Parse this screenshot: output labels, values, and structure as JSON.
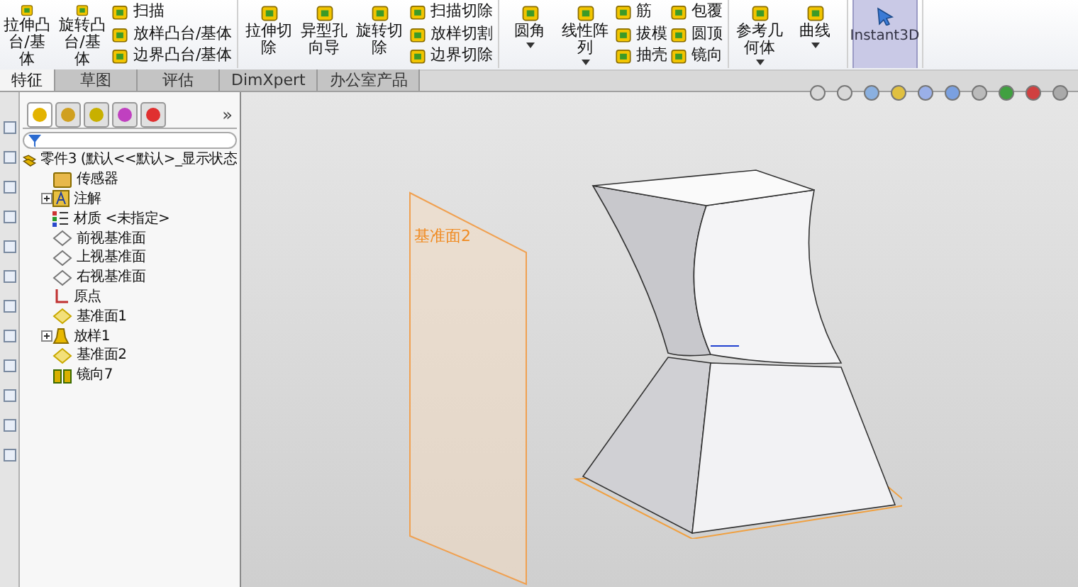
{
  "ribbon": {
    "groups": [
      [
        {
          "kind": "large",
          "label": "拉伸凸台/基体"
        },
        {
          "kind": "large",
          "label": "旋转凸台/基体"
        },
        {
          "kind": "stack",
          "items": [
            "扫描",
            "放样凸台/基体",
            "边界凸台/基体"
          ]
        }
      ],
      [
        {
          "kind": "large",
          "label": "拉伸切除"
        },
        {
          "kind": "large",
          "label": "异型孔向导"
        },
        {
          "kind": "large",
          "label": "旋转切除"
        },
        {
          "kind": "stack",
          "items": [
            "扫描切除",
            "放样切割",
            "边界切除"
          ]
        }
      ],
      [
        {
          "kind": "large",
          "label": "圆角",
          "dropdown": true
        },
        {
          "kind": "large",
          "label": "线性阵列",
          "dropdown": true
        },
        {
          "kind": "stack",
          "items": [
            "筋",
            "拔模",
            "抽壳"
          ]
        },
        {
          "kind": "stack",
          "items": [
            "包覆",
            "圆顶",
            "镜向"
          ]
        }
      ],
      [
        {
          "kind": "large",
          "label": "参考几何体",
          "dropdown": true
        },
        {
          "kind": "large",
          "label": "曲线",
          "dropdown": true
        }
      ],
      [
        {
          "kind": "toggle",
          "label": "Instant3D",
          "on": true
        }
      ]
    ]
  },
  "tabs": [
    {
      "label": "特征",
      "selected": true
    },
    {
      "label": "草图",
      "selected": false
    },
    {
      "label": "评估",
      "selected": false
    },
    {
      "label": "DimXpert",
      "selected": false
    },
    {
      "label": "办公室产品",
      "selected": false
    }
  ],
  "tree_panel": {
    "more": "»",
    "tree": [
      {
        "label": "零件3 (默认<<默认>_显示状态",
        "kind": "part",
        "collapsed": false,
        "children": [
          {
            "label": "传感器",
            "kind": "sensor",
            "collapsed": false
          },
          {
            "label": "注解",
            "kind": "annotation",
            "collapsed": true
          },
          {
            "label": "材质 <未指定>",
            "kind": "material",
            "collapsed": false
          },
          {
            "label": "前视基准面",
            "kind": "plane",
            "collapsed": false
          },
          {
            "label": "上视基准面",
            "kind": "plane",
            "collapsed": false
          },
          {
            "label": "右视基准面",
            "kind": "plane",
            "collapsed": false
          },
          {
            "label": "原点",
            "kind": "origin",
            "collapsed": false
          },
          {
            "label": "基准面1",
            "kind": "refplane",
            "collapsed": false
          },
          {
            "label": "放样1",
            "kind": "loft",
            "collapsed": true
          },
          {
            "label": "基准面2",
            "kind": "refplane",
            "collapsed": false
          },
          {
            "label": "镜向7",
            "kind": "mirror",
            "collapsed": false
          }
        ]
      }
    ]
  },
  "viewport": {
    "plane_label": "基准面2"
  }
}
